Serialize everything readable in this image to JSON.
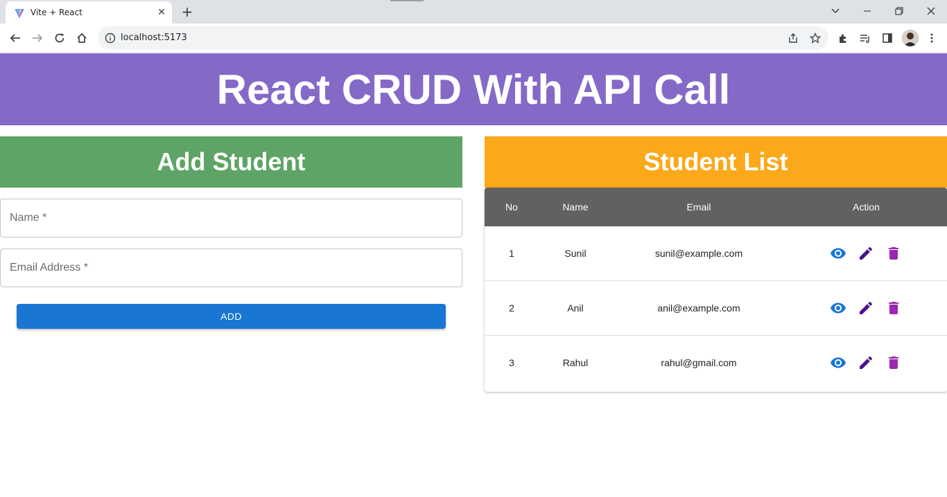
{
  "browser": {
    "tab_title": "Vite + React",
    "url": "localhost:5173",
    "tab_close_glyph": "✕",
    "new_tab_glyph": "+"
  },
  "header": {
    "title": "React CRUD With API Call",
    "background": "#8569c7"
  },
  "add_student": {
    "title": "Add Student",
    "background": "#5ea466",
    "name_placeholder": "Name *",
    "email_placeholder": "Email Address *",
    "name_value": "",
    "email_value": "",
    "add_button_label": "ADD",
    "button_color": "#1976d2"
  },
  "student_list": {
    "title": "Student List",
    "background": "#fba81b",
    "columns": [
      "No",
      "Name",
      "Email",
      "Action"
    ],
    "rows": [
      {
        "no": "1",
        "name": "Sunil",
        "email": "sunil@example.com"
      },
      {
        "no": "2",
        "name": "Anil",
        "email": "anil@example.com"
      },
      {
        "no": "3",
        "name": "Rahul",
        "email": "rahul@gmail.com"
      }
    ],
    "action_icons": [
      "eye-icon",
      "edit-icon",
      "delete-icon"
    ],
    "icon_colors": {
      "view": "#1976d2",
      "edit": "#4a148c",
      "delete": "#9c27b0"
    }
  }
}
